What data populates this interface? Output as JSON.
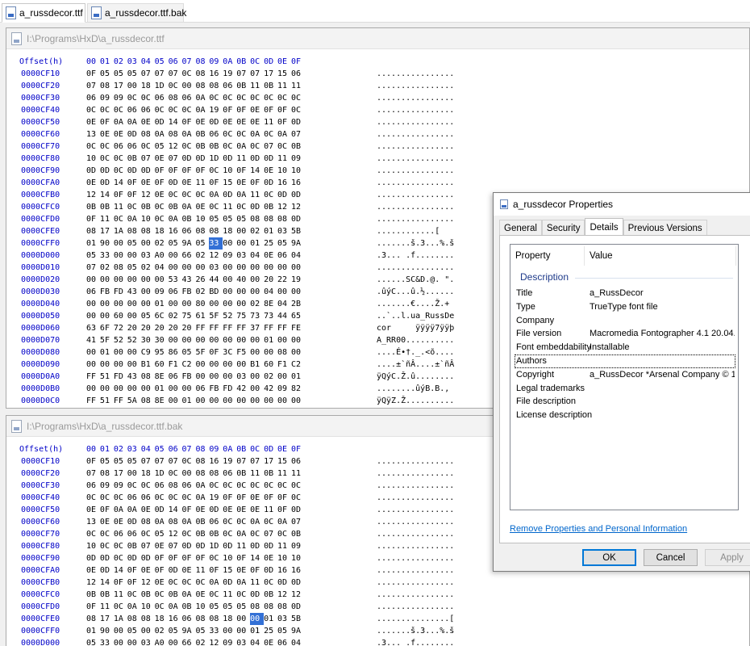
{
  "tabs": [
    {
      "label": "a_russdecor.ttf",
      "active": true
    },
    {
      "label": "a_russdecor.ttf.bak",
      "active": false
    }
  ],
  "pane1": {
    "path": "I:\\Programs\\HxD\\a_russdecor.ttf",
    "header_label": "Offset(h)",
    "columns": [
      "00",
      "01",
      "02",
      "03",
      "04",
      "05",
      "06",
      "07",
      "08",
      "09",
      "0A",
      "0B",
      "0C",
      "0D",
      "0E",
      "0F"
    ],
    "selected": {
      "row": 14,
      "col": 9
    },
    "rows": [
      {
        "offset": "0000CF10",
        "bytes": "0F 05 05 05 07 07 07 0C 08 16 19 07 07 17 15 06",
        "ascii": "................"
      },
      {
        "offset": "0000CF20",
        "bytes": "07 08 17 00 18 1D 0C 00 08 08 06 0B 11 0B 11 11",
        "ascii": "................"
      },
      {
        "offset": "0000CF30",
        "bytes": "06 09 09 0C 0C 06 08 06 0A 0C 0C 0C 0C 0C 0C 0C",
        "ascii": "................"
      },
      {
        "offset": "0000CF40",
        "bytes": "0C 0C 0C 06 06 0C 0C 0C 0A 19 0F 0F 0E 0F 0F 0C",
        "ascii": "................"
      },
      {
        "offset": "0000CF50",
        "bytes": "0E 0F 0A 0A 0E 0D 14 0F 0E 0D 0E 0E 0E 11 0F 0D",
        "ascii": "................"
      },
      {
        "offset": "0000CF60",
        "bytes": "13 0E 0E 0D 08 0A 08 0A 0B 06 0C 0C 0A 0C 0A 07",
        "ascii": "................"
      },
      {
        "offset": "0000CF70",
        "bytes": "0C 0C 06 06 0C 05 12 0C 0B 0B 0C 0A 0C 07 0C 0B",
        "ascii": "................"
      },
      {
        "offset": "0000CF80",
        "bytes": "10 0C 0C 0B 07 0E 07 0D 0D 1D 0D 11 0D 0D 11 09",
        "ascii": "................"
      },
      {
        "offset": "0000CF90",
        "bytes": "0D 0D 0C 0D 0D 0F 0F 0F 0F 0C 10 0F 14 0E 10 10",
        "ascii": "................"
      },
      {
        "offset": "0000CFA0",
        "bytes": "0E 0D 14 0F 0E 0F 0D 0E 11 0F 15 0E 0F 0D 16 16",
        "ascii": "................"
      },
      {
        "offset": "0000CFB0",
        "bytes": "12 14 0F 0F 12 0E 0C 0C 0C 0A 0D 0A 11 0C 0D 0D",
        "ascii": "................"
      },
      {
        "offset": "0000CFC0",
        "bytes": "0B 0B 11 0C 0B 0C 0B 0A 0E 0C 11 0C 0D 0B 12 12",
        "ascii": "................"
      },
      {
        "offset": "0000CFD0",
        "bytes": "0F 11 0C 0A 10 0C 0A 0B 10 05 05 05 08 08 08 0D",
        "ascii": "................"
      },
      {
        "offset": "0000CFE0",
        "bytes": "08 17 1A 08 08 18 16 06 08 08 18 00 02 01 03 5B",
        "ascii": "............[",
        "ascii_full": "............|..["
      },
      {
        "offset": "0000CFF0",
        "bytes": "01 90 00 05 00 02 05 9A 05 33 00 00 01 25 05 9A",
        "ascii": ".......š.3...%.š"
      },
      {
        "offset": "0000D000",
        "bytes": "05 33 00 00 03 A0 00 66 02 12 09 03 04 0E 06 04",
        "ascii": ".3... .f........"
      },
      {
        "offset": "0000D010",
        "bytes": "07 02 08 05 02 04 00 00 00 03 00 00 00 00 00 00",
        "ascii": "................"
      },
      {
        "offset": "0000D020",
        "bytes": "00 00 00 00 00 00 53 43 26 44 00 40 00 20 22 19",
        "ascii": "......SC&D.@. \"."
      },
      {
        "offset": "0000D030",
        "bytes": "06 FB FD 43 00 09 06 FB 02 BD 00 00 00 04 00 00",
        "ascii": ".ûýC...û.½......"
      },
      {
        "offset": "0000D040",
        "bytes": "00 00 00 00 00 01 00 00 80 00 00 00 02 8E 04 2B",
        "ascii": ".......€....Ž.+"
      },
      {
        "offset": "0000D050",
        "bytes": "00 00 60 00 05 6C 02 75 61 5F 52 75 73 73 44 65",
        "ascii": "..`..l.ua_RussDe"
      },
      {
        "offset": "0000D060",
        "bytes": "63 6F 72 20 20 20 20 20 FF FF FF FF 37 FF FF FE",
        "ascii": "cor     ÿÿÿÿ7ÿÿþ"
      },
      {
        "offset": "0000D070",
        "bytes": "41 5F 52 52 30 30 00 00 00 00 00 00 00 01 00 00",
        "ascii": "A_RR00.........."
      },
      {
        "offset": "0000D080",
        "bytes": "00 01 00 00 C9 95 86 05 5F 0F 3C F5 00 00 08 00",
        "ascii": "....É•†._.<õ...."
      },
      {
        "offset": "0000D090",
        "bytes": "00 00 00 00 B1 60 F1 C2 00 00 00 00 B1 60 F1 C2",
        "ascii": "....±`ñÂ....±`ñÂ"
      },
      {
        "offset": "0000D0A0",
        "bytes": "FF 51 FD 43 08 8E 06 FB 00 00 00 03 00 02 00 01",
        "ascii": "ÿQýC.Ž.û........"
      },
      {
        "offset": "0000D0B0",
        "bytes": "00 00 00 00 00 01 00 00 06 FB FD 42 00 42 09 82",
        "ascii": "........ûýB.B.,"
      },
      {
        "offset": "0000D0C0",
        "bytes": "FF 51 FF 5A 08 8E 00 01 00 00 00 00 00 00 00 00",
        "ascii": "ÿQÿZ.Ž.........."
      }
    ]
  },
  "pane2": {
    "path": "I:\\Programs\\HxD\\a_russdecor.ttf.bak",
    "header_label": "Offset(h)",
    "columns": [
      "00",
      "01",
      "02",
      "03",
      "04",
      "05",
      "06",
      "07",
      "08",
      "09",
      "0A",
      "0B",
      "0C",
      "0D",
      "0E",
      "0F"
    ],
    "selected": {
      "row": 13,
      "col": 12
    },
    "rows": [
      {
        "offset": "0000CF10",
        "bytes": "0F 05 05 05 07 07 07 0C 08 16 19 07 07 17 15 06",
        "ascii": "................"
      },
      {
        "offset": "0000CF20",
        "bytes": "07 08 17 00 18 1D 0C 00 08 08 06 0B 11 0B 11 11",
        "ascii": "................"
      },
      {
        "offset": "0000CF30",
        "bytes": "06 09 09 0C 0C 06 08 06 0A 0C 0C 0C 0C 0C 0C 0C",
        "ascii": "................"
      },
      {
        "offset": "0000CF40",
        "bytes": "0C 0C 0C 06 06 0C 0C 0C 0A 19 0F 0F 0E 0F 0F 0C",
        "ascii": "................"
      },
      {
        "offset": "0000CF50",
        "bytes": "0E 0F 0A 0A 0E 0D 14 0F 0E 0D 0E 0E 0E 11 0F 0D",
        "ascii": "................"
      },
      {
        "offset": "0000CF60",
        "bytes": "13 0E 0E 0D 08 0A 08 0A 0B 06 0C 0C 0A 0C 0A 07",
        "ascii": "................"
      },
      {
        "offset": "0000CF70",
        "bytes": "0C 0C 06 06 0C 05 12 0C 0B 0B 0C 0A 0C 07 0C 0B",
        "ascii": "................"
      },
      {
        "offset": "0000CF80",
        "bytes": "10 0C 0C 0B 07 0E 07 0D 0D 1D 0D 11 0D 0D 11 09",
        "ascii": "................"
      },
      {
        "offset": "0000CF90",
        "bytes": "0D 0D 0C 0D 0D 0F 0F 0F 0F 0C 10 0F 14 0E 10 10",
        "ascii": "................"
      },
      {
        "offset": "0000CFA0",
        "bytes": "0E 0D 14 0F 0E 0F 0D 0E 11 0F 15 0E 0F 0D 16 16",
        "ascii": "................"
      },
      {
        "offset": "0000CFB0",
        "bytes": "12 14 0F 0F 12 0E 0C 0C 0C 0A 0D 0A 11 0C 0D 0D",
        "ascii": "................"
      },
      {
        "offset": "0000CFC0",
        "bytes": "0B 0B 11 0C 0B 0C 0B 0A 0E 0C 11 0C 0D 0B 12 12",
        "ascii": "................"
      },
      {
        "offset": "0000CFD0",
        "bytes": "0F 11 0C 0A 10 0C 0A 0B 10 05 05 05 08 08 08 0D",
        "ascii": "................"
      },
      {
        "offset": "0000CFE0",
        "bytes": "08 17 1A 08 08 18 16 06 08 08 18 00 00 01 03 5B",
        "ascii": "...............["
      },
      {
        "offset": "0000CFF0",
        "bytes": "01 90 00 05 00 02 05 9A 05 33 00 00 01 25 05 9A",
        "ascii": ".......š.3...%.š"
      },
      {
        "offset": "0000D000",
        "bytes": "05 33 00 00 03 A0 00 66 02 12 09 03 04 0E 06 04",
        "ascii": ".3... .f........"
      }
    ]
  },
  "dialog": {
    "title": "a_russdecor Properties",
    "tabs": [
      "General",
      "Security",
      "Details",
      "Previous Versions"
    ],
    "active_tab": "Details",
    "columns": {
      "property": "Property",
      "value": "Value"
    },
    "group": "Description",
    "props": [
      {
        "key": "Title",
        "value": "a_RussDecor"
      },
      {
        "key": "Type",
        "value": "TrueType font file"
      },
      {
        "key": "Company",
        "value": ""
      },
      {
        "key": "File version",
        "value": "Macromedia Fontographer 4.1 20.04..."
      },
      {
        "key": "Font embeddability",
        "value": "Installable"
      },
      {
        "key": "Authors",
        "value": ""
      },
      {
        "key": "Copyright",
        "value": "a_RussDecor *Arsenal Company © 1..."
      },
      {
        "key": "Legal trademarks",
        "value": ""
      },
      {
        "key": "File description",
        "value": ""
      },
      {
        "key": "License description",
        "value": ""
      }
    ],
    "focused": "Authors",
    "link": "Remove Properties and Personal Information",
    "buttons": {
      "ok": "OK",
      "cancel": "Cancel",
      "apply": "Apply"
    }
  }
}
